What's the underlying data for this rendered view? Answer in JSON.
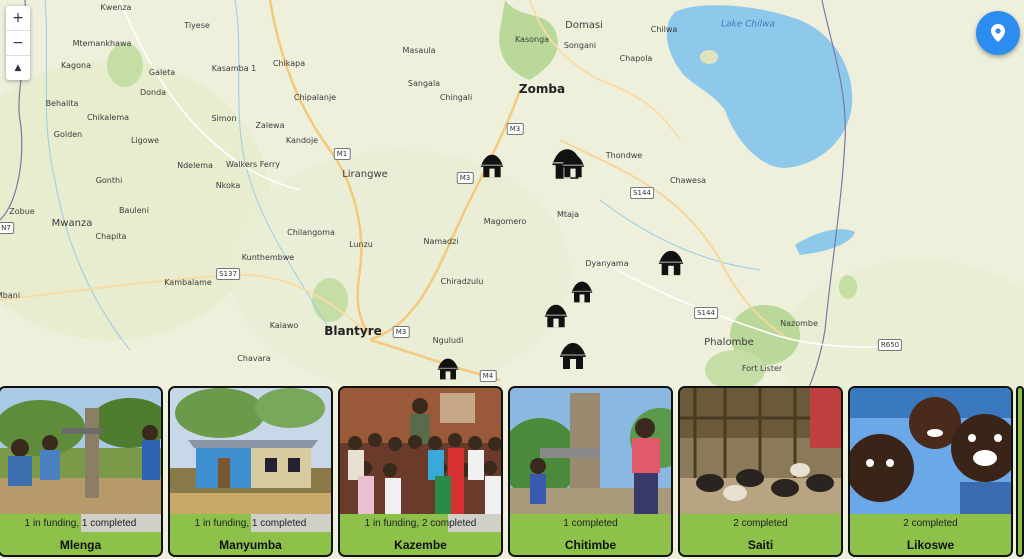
{
  "map": {
    "lake_label": "Lake Chilwa",
    "places": [
      {
        "name": "Kwenza",
        "size": "small"
      },
      {
        "name": "Tiyese",
        "size": "small"
      },
      {
        "name": "Mtemankhawa",
        "size": "small"
      },
      {
        "name": "Kagona",
        "size": "small"
      },
      {
        "name": "Galeta",
        "size": "small"
      },
      {
        "name": "Kasamba 1",
        "size": "small"
      },
      {
        "name": "Chikapa",
        "size": "small"
      },
      {
        "name": "Masaula",
        "size": "small"
      },
      {
        "name": "Kasonga",
        "size": "small"
      },
      {
        "name": "Songani",
        "size": "small"
      },
      {
        "name": "Domasi",
        "size": "med"
      },
      {
        "name": "Chilwa",
        "size": "small"
      },
      {
        "name": "Chapola",
        "size": "small"
      },
      {
        "name": "Behalita",
        "size": "small"
      },
      {
        "name": "Donda",
        "size": "small"
      },
      {
        "name": "Chipalanje",
        "size": "small"
      },
      {
        "name": "Sangala",
        "size": "small"
      },
      {
        "name": "Chingali",
        "size": "small"
      },
      {
        "name": "Zomba",
        "size": "big"
      },
      {
        "name": "Chikalema",
        "size": "small"
      },
      {
        "name": "Simon",
        "size": "small"
      },
      {
        "name": "Zalewa",
        "size": "small"
      },
      {
        "name": "Golden",
        "size": "small"
      },
      {
        "name": "Ligowe",
        "size": "small"
      },
      {
        "name": "Kandoje",
        "size": "small"
      },
      {
        "name": "Ndelema",
        "size": "small"
      },
      {
        "name": "Walkers Ferry",
        "size": "small"
      },
      {
        "name": "Thondwe",
        "size": "small"
      },
      {
        "name": "Gonthi",
        "size": "small"
      },
      {
        "name": "Nkoka",
        "size": "small"
      },
      {
        "name": "Lirangwe",
        "size": "med"
      },
      {
        "name": "Chawesa",
        "size": "small"
      },
      {
        "name": "Zobue",
        "size": "small"
      },
      {
        "name": "Mwanza",
        "size": "med"
      },
      {
        "name": "Bauleni",
        "size": "small"
      },
      {
        "name": "Mtaja",
        "size": "small"
      },
      {
        "name": "Magomero",
        "size": "small"
      },
      {
        "name": "Chapita",
        "size": "small"
      },
      {
        "name": "Chilangoma",
        "size": "small"
      },
      {
        "name": "Lunzu",
        "size": "small"
      },
      {
        "name": "Namadzi",
        "size": "small"
      },
      {
        "name": "Kunthembwe",
        "size": "small"
      },
      {
        "name": "Dyanyama",
        "size": "small"
      },
      {
        "name": "Kambalame",
        "size": "small"
      },
      {
        "name": "Chiradzulu",
        "size": "small"
      },
      {
        "name": "Mbani",
        "size": "small"
      },
      {
        "name": "Kaiawo",
        "size": "small"
      },
      {
        "name": "Nazombe",
        "size": "small"
      },
      {
        "name": "Blantyre",
        "size": "big"
      },
      {
        "name": "Phalombe",
        "size": "med"
      },
      {
        "name": "Chavara",
        "size": "small"
      },
      {
        "name": "Nguludi",
        "size": "small"
      },
      {
        "name": "Fort Lister",
        "size": "small"
      }
    ],
    "road_shields": [
      "M3",
      "M1",
      "M3",
      "S144",
      "S137",
      "M3",
      "M4",
      "S144",
      "R650",
      "N7"
    ],
    "markers": [
      "Mlenga",
      "Manyumba",
      "Kazembe",
      "Chitimbe",
      "Saiti",
      "Likoswe",
      "Mlenga-2",
      "Chitimbe-2"
    ]
  },
  "controls": {
    "zoom_in": "+",
    "zoom_out": "−",
    "compass": "▲"
  },
  "cards": [
    {
      "name": "Mlenga",
      "status": "1 in funding, 1 completed",
      "progress": 0.5,
      "photo": "handpump-children"
    },
    {
      "name": "Manyumba",
      "status": "1 in funding, 1 completed",
      "progress": 0.5,
      "photo": "blue-building"
    },
    {
      "name": "Kazembe",
      "status": "1 in funding, 2 completed",
      "progress": 0.67,
      "photo": "group-of-children"
    },
    {
      "name": "Chitimbe",
      "status": "1 completed",
      "progress": 1,
      "photo": "woman-at-pump"
    },
    {
      "name": "Saiti",
      "status": "2 completed",
      "progress": 1,
      "photo": "goats-in-pen"
    },
    {
      "name": "Likoswe",
      "status": "2 completed",
      "progress": 1,
      "photo": "smiling-kids"
    }
  ]
}
